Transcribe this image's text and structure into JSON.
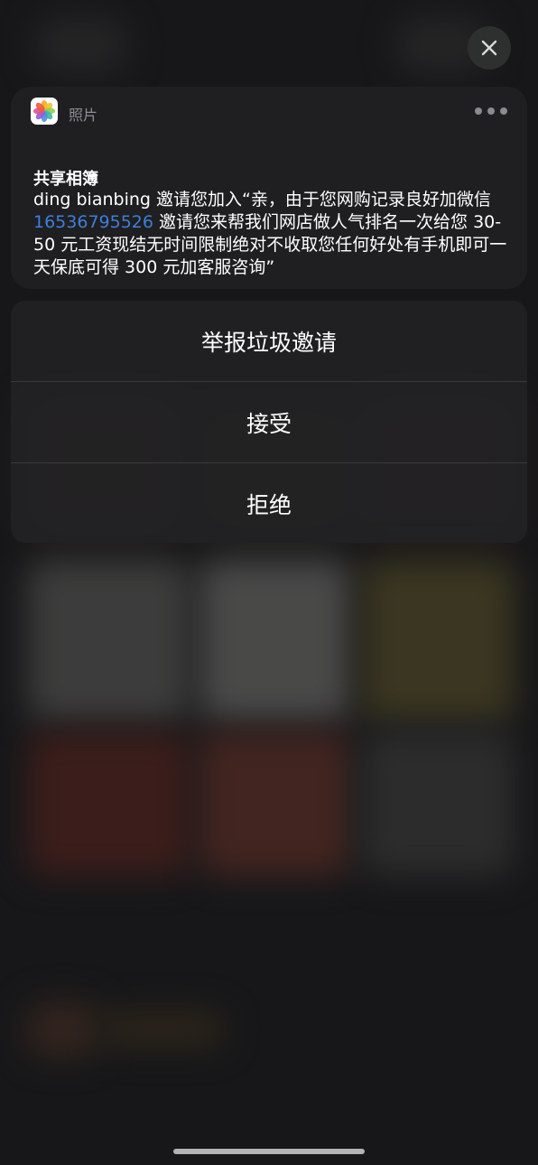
{
  "notification": {
    "app_name": "照片",
    "title": "共享相簿",
    "body_prefix": "ding bianbing 邀请您加入“亲，由于您网购记录良好加微信 ",
    "phone": "16536795526",
    "body_suffix": " 邀请您来帮我们网店做人气排名一次给您 30-50 元工资现结无时间限制绝对不收取您任何好处有手机即可一天保底可得 300 元加客服咨询”"
  },
  "actions": {
    "report": "举报垃圾邀请",
    "accept": "接受",
    "decline": "拒绝"
  },
  "colors": {
    "link": "#3f7ed8",
    "background": "#1b1b1d"
  },
  "icons": {
    "close": "close-icon",
    "more": "more-icon",
    "photos": "photos-app-icon"
  }
}
